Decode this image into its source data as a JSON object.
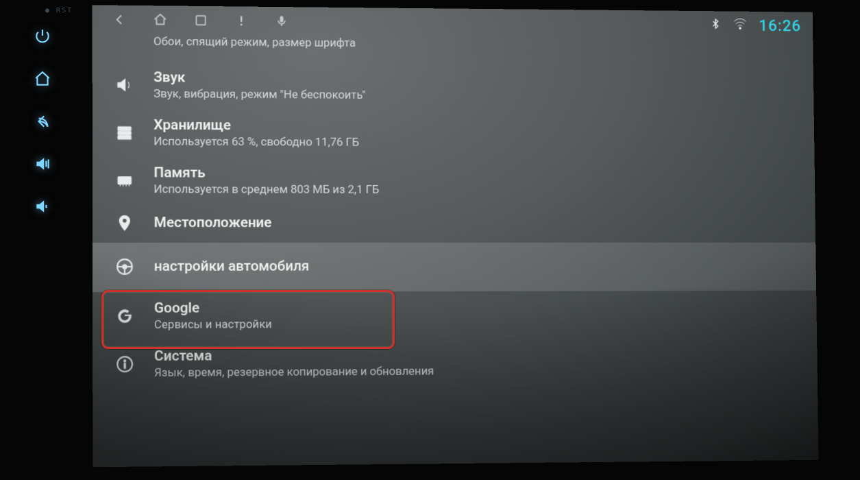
{
  "device": {
    "rst_label": "● RST"
  },
  "status": {
    "time": "16:26"
  },
  "settings": [
    {
      "key": "display",
      "icon": "display-icon",
      "title": "",
      "subtitle": "Обои, спящий режим, размер шрифта",
      "partial": true
    },
    {
      "key": "sound",
      "icon": "sound-icon",
      "title": "Звук",
      "subtitle": "Звук, вибрация, режим \"Не беспокоить\""
    },
    {
      "key": "storage",
      "icon": "storage-icon",
      "title": "Хранилище",
      "subtitle": "Используется 63 %, свободно 11,76 ГБ"
    },
    {
      "key": "memory",
      "icon": "memory-icon",
      "title": "Память",
      "subtitle": "Используется в среднем 803 МБ из 2,1 ГБ"
    },
    {
      "key": "location",
      "icon": "location-icon",
      "title": "Местоположение",
      "subtitle": ""
    },
    {
      "key": "car",
      "icon": "steering-icon",
      "title": "настройки автомобиля",
      "subtitle": "",
      "selected": true,
      "highlighted": true
    },
    {
      "key": "google",
      "icon": "google-icon",
      "title": "Google",
      "subtitle": "Сервисы и настройки"
    },
    {
      "key": "system",
      "icon": "info-icon",
      "title": "Система",
      "subtitle": "Язык, время, резервное копирование и обновления"
    }
  ]
}
